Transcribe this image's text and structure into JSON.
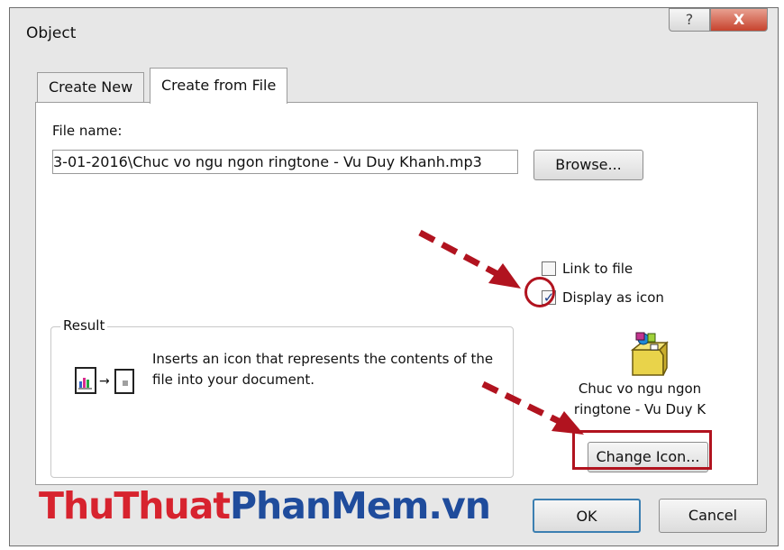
{
  "dialog": {
    "title": "Object",
    "help_glyph": "?",
    "close_glyph": "X"
  },
  "tabs": [
    {
      "label": "Create New"
    },
    {
      "label": "Create from File"
    }
  ],
  "file": {
    "label": "File name:",
    "value": "3-01-2016\\Chuc vo ngu ngon ringtone - Vu Duy Khanh.mp3",
    "browse_label": "Browse..."
  },
  "options": {
    "link_label": "Link to file",
    "link_checked": false,
    "display_label": "Display as icon",
    "display_checked": true
  },
  "result": {
    "title": "Result",
    "text": "Inserts an icon that represents the contents of the file into your document."
  },
  "preview": {
    "caption_line1": "Chuc vo ngu ngon",
    "caption_line2": "ringtone - Vu Duy K",
    "change_icon_label": "Change Icon..."
  },
  "footer": {
    "ok_label": "OK",
    "cancel_label": "Cancel"
  },
  "watermark": {
    "part1": "ThuThuat",
    "part2": "PhanMem",
    "part3": ".vn"
  },
  "colors": {
    "highlight": "#b1131f",
    "watermark_red": "#d7232e",
    "watermark_blue": "#1f4c9c"
  }
}
